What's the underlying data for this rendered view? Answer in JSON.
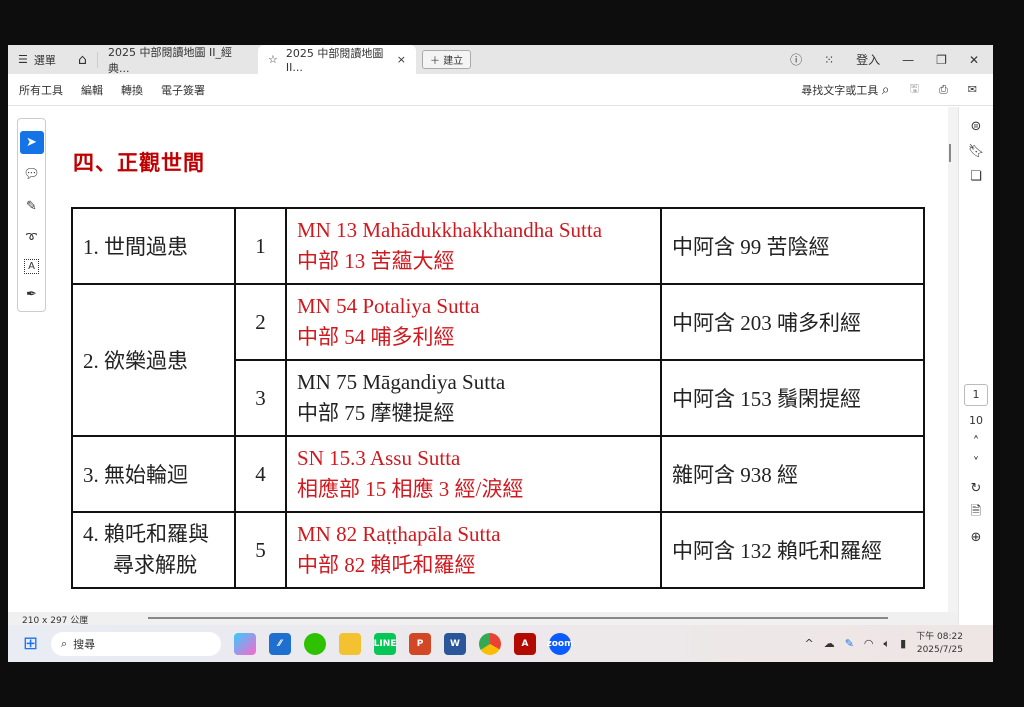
{
  "titlebar": {
    "menu_label": "選單",
    "tabs": [
      {
        "label": "2025 中部閱讀地圖 II_經典..."
      },
      {
        "label": "2025 中部閱讀地圖II...",
        "close": "×"
      }
    ],
    "new_tab": "建立",
    "sign_in": "登入"
  },
  "toolbar": {
    "items": [
      "所有工具",
      "編輯",
      "轉換",
      "電子簽署"
    ],
    "search": "尋找文字或工具"
  },
  "document": {
    "heading": "四、正觀世間",
    "rows": [
      {
        "topic": "1. 世間過患",
        "num": "1",
        "pali": "MN 13 Mahādukkhakkhandha Sutta",
        "chinese": "中部 13 苦蘊大經",
        "agama": "中阿含 99 苦陰經",
        "red": true
      },
      {
        "topic": "2. 欲樂過患",
        "num": "2",
        "pali": "MN 54 Potaliya Sutta",
        "chinese": "中部 54 哺多利經",
        "agama": "中阿含 203 哺多利經",
        "red": true
      },
      {
        "num": "3",
        "pali": "MN 75 Māgandiya Sutta",
        "chinese": "中部 75 摩犍提經",
        "agama": "中阿含 153 鬚閑提經",
        "red": false
      },
      {
        "topic": "3. 無始輪迴",
        "num": "4",
        "pali": "SN 15.3 Assu Sutta",
        "chinese": "相應部 15 相應 3 經/淚經",
        "agama": "雜阿含 938 經",
        "red": true
      },
      {
        "topic_line1": "4. 賴吒和羅與",
        "topic_line2": "尋求解脫",
        "num": "5",
        "pali": "MN 82 Raṭṭhapāla Sutta",
        "chinese": "中部 82 賴吒和羅經",
        "agama": "中阿含 132 賴吒和羅經",
        "red": true
      }
    ]
  },
  "page_nav": {
    "current": "1",
    "total": "10"
  },
  "status": {
    "page_size": "210 x 297 公厘"
  },
  "taskbar": {
    "search": "搜尋",
    "time": "下午 08:22",
    "date": "2025/7/25"
  },
  "colors": {
    "heading": "#c00000",
    "red_text": "#d0191f",
    "accent": "#1473e6"
  }
}
